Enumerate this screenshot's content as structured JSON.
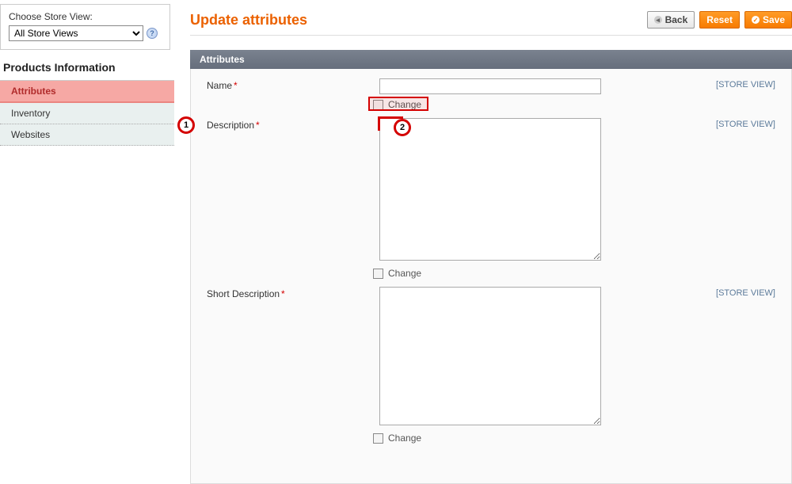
{
  "sidebar": {
    "store_view_label": "Choose Store View:",
    "store_view_value": "All Store Views",
    "title": "Products Information",
    "tabs": [
      {
        "label": "Attributes",
        "active": true
      },
      {
        "label": "Inventory",
        "active": false
      },
      {
        "label": "Websites",
        "active": false
      }
    ]
  },
  "header": {
    "title": "Update attributes",
    "back": "Back",
    "reset": "Reset",
    "save": "Save"
  },
  "panel": {
    "title": "Attributes",
    "scope": "[STORE VIEW]",
    "change_label": "Change",
    "fields": {
      "name_label": "Name",
      "description_label": "Description",
      "short_description_label": "Short Description"
    }
  },
  "annotations": {
    "one": "1",
    "two": "2"
  }
}
